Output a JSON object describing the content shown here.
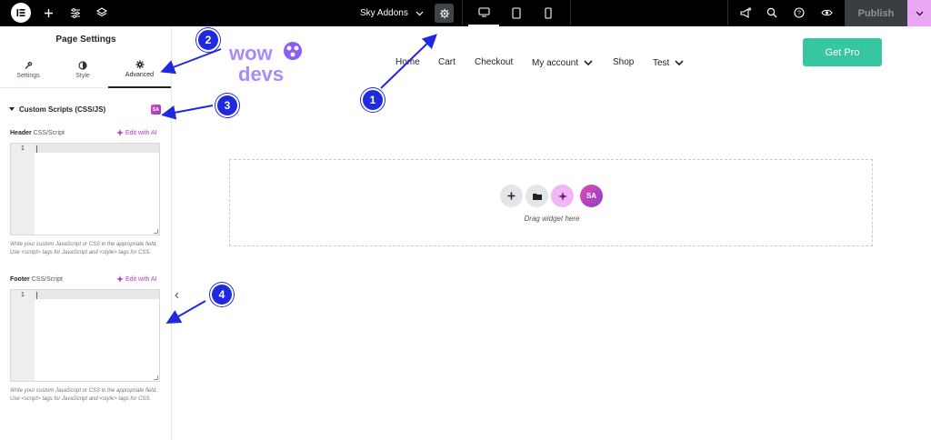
{
  "topbar": {
    "site_name": "Sky Addons",
    "publish_label": "Publish",
    "icons": [
      "elementor-logo-icon",
      "add-icon",
      "sliders-icon",
      "layers-icon",
      "chevron-down-icon",
      "gear-icon",
      "desktop-icon",
      "tablet-icon",
      "mobile-icon",
      "announcement-icon",
      "search-icon",
      "help-icon",
      "eye-icon",
      "chevron-down-icon"
    ]
  },
  "panel": {
    "title": "Page Settings",
    "tabs": [
      {
        "label": "Settings",
        "icon": "wrench-icon"
      },
      {
        "label": "Style",
        "icon": "contrast-icon"
      },
      {
        "label": "Advanced",
        "icon": "gear-icon",
        "active": true
      }
    ],
    "section_title": "Custom Scripts (CSS/JS)",
    "badge": "SA",
    "header_field": {
      "label_bold": "Header",
      "label_rest": " CSS/Script",
      "ai_label": "Edit with AI",
      "line_no": "1"
    },
    "footer_field": {
      "label_bold": "Footer",
      "label_rest": " CSS/Script",
      "ai_label": "Edit with AI",
      "line_no": "1"
    },
    "help_text": "Write your custom JavaScript or CSS in the appropriate field. Use <script> tags for JavaScript and <style> tags for CSS."
  },
  "site": {
    "logo_line1": "wow",
    "logo_line2": "devs",
    "nav": [
      {
        "label": "Home"
      },
      {
        "label": "Cart"
      },
      {
        "label": "Checkout"
      },
      {
        "label": "My account",
        "dropdown": true
      },
      {
        "label": "Shop"
      },
      {
        "label": "Test",
        "dropdown": true
      }
    ],
    "cta_label": "Get Pro"
  },
  "dropzone": {
    "text": "Drag widget here",
    "badge": "SA"
  },
  "callouts": [
    "1",
    "2",
    "3",
    "4"
  ],
  "colors": {
    "callout": "#1f2adf",
    "accent": "#c036d6",
    "cta": "#38c6a1",
    "topbar": "#000000"
  }
}
